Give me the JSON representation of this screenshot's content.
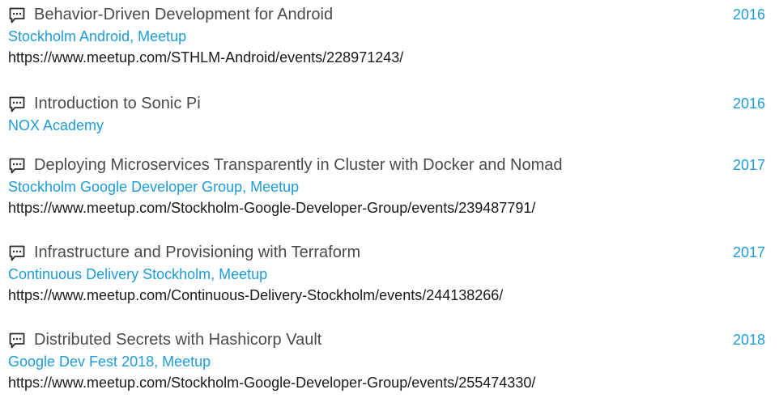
{
  "talks": [
    {
      "title": "Behavior-Driven Development for Android",
      "venue": "Stockholm Android, Meetup",
      "url": "https://www.meetup.com/STHLM-Android/events/228971243/",
      "year": "2016",
      "icon": "speech-bubble-icon"
    },
    {
      "title": "Introduction to Sonic Pi",
      "venue": "NOX Academy",
      "url": "",
      "year": "2016",
      "icon": "speech-bubble-icon"
    },
    {
      "title": "Deploying Microservices Transparently in Cluster with Docker and Nomad",
      "venue": "Stockholm Google Developer Group, Meetup",
      "url": "https://www.meetup.com/Stockholm-Google-Developer-Group/events/239487791/",
      "year": "2017",
      "icon": "speech-bubble-icon"
    },
    {
      "title": "Infrastructure and Provisioning with Terraform",
      "venue": "Continuous Delivery Stockholm, Meetup",
      "url": "https://www.meetup.com/Continuous-Delivery-Stockholm/events/244138266/",
      "year": "2017",
      "icon": "speech-bubble-icon"
    },
    {
      "title": "Distributed Secrets with Hashicorp Vault",
      "venue": "Google Dev Fest 2018, Meetup",
      "url": "https://www.meetup.com/Stockholm-Google-Developer-Group/events/255474330/",
      "year": "2018",
      "icon": "speech-bubble-icon"
    }
  ],
  "colors": {
    "accent": "#1e9cd7",
    "title": "#4a4a4a",
    "url": "#1a1a1a"
  }
}
